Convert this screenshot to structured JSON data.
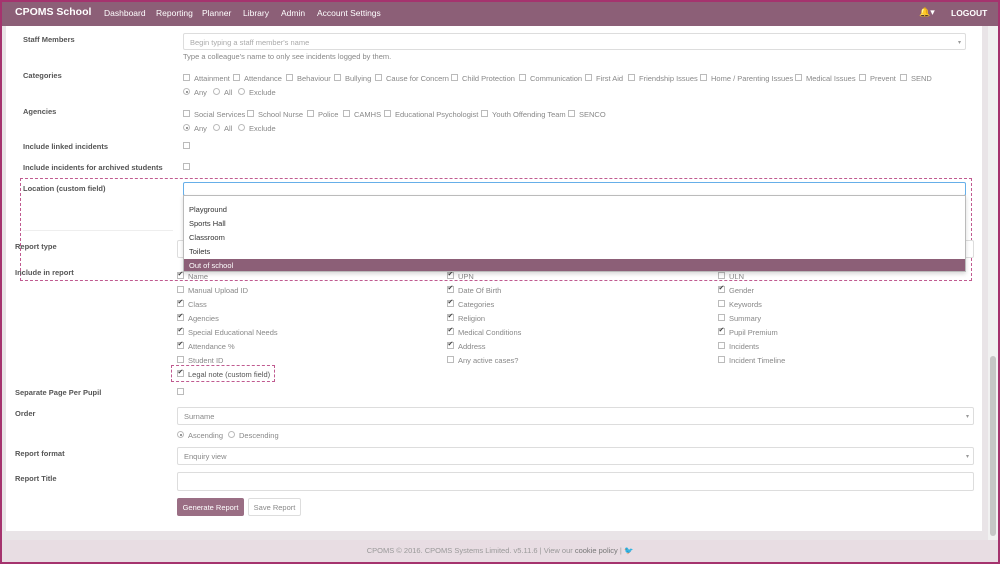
{
  "nav": {
    "brand": "CPOMS School",
    "items": [
      "Dashboard",
      "Reporting",
      "Planner",
      "Library",
      "Admin",
      "Account Settings"
    ],
    "bell": "🔔▾",
    "logout": "LOGOUT"
  },
  "staff": {
    "label": "Staff Members",
    "placeholder": "Begin typing a staff member's name",
    "help": "Type a colleague's name to only see incidents logged by them."
  },
  "categories": {
    "label": "Categories",
    "items": [
      "Attainment",
      "Attendance",
      "Behaviour",
      "Bullying",
      "Cause for Concern",
      "Child Protection",
      "Communication",
      "First Aid",
      "Friendship Issues",
      "Home / Parenting Issues",
      "Medical Issues",
      "Prevent",
      "SEND"
    ],
    "modes": [
      "Any",
      "All",
      "Exclude"
    ]
  },
  "agencies": {
    "label": "Agencies",
    "items": [
      "Social Services",
      "School Nurse",
      "Police",
      "CAMHS",
      "Educational Psychologist",
      "Youth Offending Team",
      "SENCO"
    ],
    "modes": [
      "Any",
      "All",
      "Exclude"
    ]
  },
  "linked": {
    "label": "Include linked incidents"
  },
  "archived": {
    "label": "Include incidents for archived students"
  },
  "location": {
    "label": "Location (custom field)",
    "options": [
      "Playground",
      "Sports Hall",
      "Classroom",
      "Toilets",
      "Out of school"
    ]
  },
  "report_type": {
    "label": "Report type"
  },
  "include": {
    "label": "Include in report",
    "col1": [
      {
        "t": "Name",
        "c": true
      },
      {
        "t": "Manual Upload ID",
        "c": false
      },
      {
        "t": "Class",
        "c": true
      },
      {
        "t": "Agencies",
        "c": true
      },
      {
        "t": "Special Educational Needs",
        "c": true
      },
      {
        "t": "Attendance %",
        "c": true
      },
      {
        "t": "Student ID",
        "c": false
      }
    ],
    "col2": [
      {
        "t": "UPN",
        "c": true
      },
      {
        "t": "Date Of Birth",
        "c": true
      },
      {
        "t": "Categories",
        "c": true
      },
      {
        "t": "Religion",
        "c": true
      },
      {
        "t": "Medical Conditions",
        "c": true
      },
      {
        "t": "Address",
        "c": true
      },
      {
        "t": "Any active cases?",
        "c": false
      }
    ],
    "col3": [
      {
        "t": "ULN",
        "c": false
      },
      {
        "t": "Gender",
        "c": true
      },
      {
        "t": "Keywords",
        "c": false
      },
      {
        "t": "Summary",
        "c": false
      },
      {
        "t": "Pupil Premium",
        "c": true
      },
      {
        "t": "Incidents",
        "c": false
      },
      {
        "t": "Incident Timeline",
        "c": false
      }
    ],
    "legal": "Legal note (custom field)"
  },
  "separate": {
    "label": "Separate Page Per Pupil"
  },
  "order": {
    "label": "Order",
    "value": "Surname",
    "asc": "Ascending",
    "desc": "Descending"
  },
  "format": {
    "label": "Report format",
    "value": "Enquiry view"
  },
  "title": {
    "label": "Report Title",
    "value": ""
  },
  "buttons": {
    "generate": "Generate Report",
    "save": "Save Report"
  },
  "footer": {
    "text": "CPOMS © 2016. CPOMS Systems Limited. v5.11.6 | View our",
    "link": "cookie policy",
    "sep": "|"
  },
  "colors": {
    "brand": "#8c5f77",
    "accent": "#a5336e"
  }
}
